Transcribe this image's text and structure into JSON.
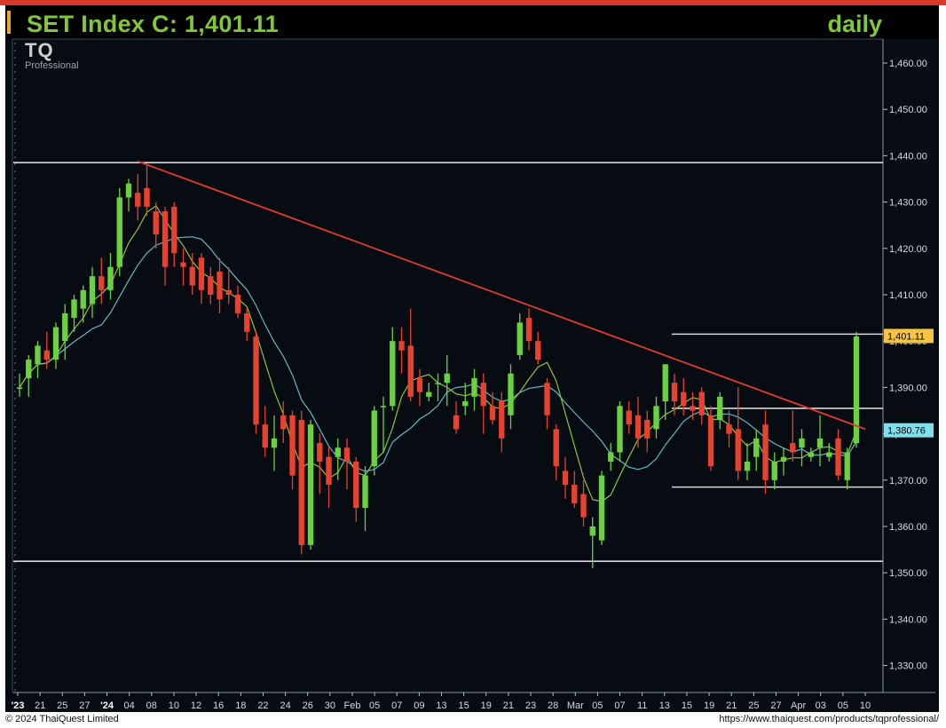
{
  "header": {
    "title": "SET Index C: 1,401.11",
    "timeframe": "daily",
    "logo_text": "TQ",
    "logo_sub": "Professional"
  },
  "footer": {
    "copyright": "© 2024 ThaiQuest Limited",
    "url": "https://www.thaiquest.com/products/tqprofessional/"
  },
  "colors": {
    "up": "#6ad23f",
    "down": "#e8412e",
    "ma_fast": "#8cc63e",
    "ma_slow": "#5fb9c9",
    "trendline": "#e23b2e",
    "hline": "#d9d9d9",
    "background": "#070b12",
    "title": "#7fc83a"
  },
  "chart_data": {
    "type": "candlestick",
    "ylim": [
      1325,
      1465
    ],
    "yticks": [
      "1,460.00",
      "1,450.00",
      "1,440.00",
      "1,430.00",
      "1,420.00",
      "1,410.00",
      "1,400.00",
      "1,390.00",
      "1,380.00",
      "1,370.00",
      "1,360.00",
      "1,350.00",
      "1,340.00",
      "1,330.00"
    ],
    "ytick_values": [
      1460,
      1450,
      1440,
      1430,
      1420,
      1410,
      1400,
      1390,
      1380,
      1370,
      1360,
      1350,
      1340,
      1330
    ],
    "xticks": [
      "'23",
      "21",
      "25",
      "27",
      "'24",
      "04",
      "08",
      "10",
      "12",
      "16",
      "18",
      "22",
      "24",
      "26",
      "30",
      "Feb",
      "05",
      "07",
      "09",
      "13",
      "15",
      "19",
      "21",
      "23",
      "28",
      "Mar",
      "05",
      "07",
      "11",
      "13",
      "15",
      "19",
      "21",
      "25",
      "27",
      "Apr",
      "03",
      "05",
      "10"
    ],
    "price_labels": [
      {
        "text": "1,401.11",
        "value": 1401.11,
        "style": "last"
      },
      {
        "text": "1,380.76",
        "value": 1380.76,
        "style": "ma"
      }
    ],
    "hlines": [
      1438.5,
      1352.5,
      1401.5,
      1385.5,
      1368.5
    ],
    "trendline": {
      "from": {
        "index": 13,
        "value": 1438.8
      },
      "to": {
        "index": 93,
        "value": 1381
      }
    },
    "ohlc": [
      [
        1390,
        1393,
        1388,
        1390
      ],
      [
        1392,
        1397,
        1388,
        1396
      ],
      [
        1395,
        1400,
        1392,
        1399
      ],
      [
        1398,
        1402,
        1394,
        1396
      ],
      [
        1396,
        1404,
        1394,
        1403
      ],
      [
        1400,
        1408,
        1396,
        1406
      ],
      [
        1405,
        1410,
        1402,
        1409
      ],
      [
        1407,
        1412,
        1404,
        1411
      ],
      [
        1408,
        1416,
        1405,
        1414
      ],
      [
        1414,
        1418,
        1408,
        1411
      ],
      [
        1411,
        1419,
        1409,
        1416
      ],
      [
        1416,
        1433,
        1414,
        1431
      ],
      [
        1431,
        1435,
        1428,
        1434
      ],
      [
        1432,
        1436,
        1426,
        1429
      ],
      [
        1433,
        1438,
        1427,
        1429
      ],
      [
        1428,
        1430,
        1420,
        1423
      ],
      [
        1428,
        1429,
        1412,
        1416
      ],
      [
        1429,
        1430,
        1416,
        1419
      ],
      [
        1417,
        1420,
        1412,
        1416
      ],
      [
        1416,
        1419,
        1410,
        1412
      ],
      [
        1418,
        1419,
        1408,
        1411
      ],
      [
        1414,
        1416,
        1408,
        1410
      ],
      [
        1415,
        1418,
        1406,
        1409
      ],
      [
        1411,
        1416,
        1408,
        1410
      ],
      [
        1410,
        1412,
        1405,
        1406
      ],
      [
        1406,
        1407,
        1400,
        1402
      ],
      [
        1401,
        1402,
        1380,
        1382
      ],
      [
        1382,
        1386,
        1375,
        1377
      ],
      [
        1377,
        1384,
        1372,
        1379
      ],
      [
        1384,
        1387,
        1378,
        1381
      ],
      [
        1384,
        1385,
        1368,
        1371
      ],
      [
        1383,
        1385,
        1354,
        1356
      ],
      [
        1356,
        1383,
        1355,
        1382
      ],
      [
        1378,
        1380,
        1367,
        1374
      ],
      [
        1375,
        1377,
        1364,
        1369
      ],
      [
        1375,
        1379,
        1370,
        1377
      ],
      [
        1377,
        1379,
        1368,
        1374
      ],
      [
        1374,
        1375,
        1361,
        1364
      ],
      [
        1364,
        1373,
        1359,
        1371
      ],
      [
        1373,
        1386,
        1371,
        1385
      ],
      [
        1386,
        1388,
        1376,
        1386
      ],
      [
        1386,
        1403,
        1385,
        1400
      ],
      [
        1400,
        1403,
        1393,
        1398
      ],
      [
        1399,
        1407,
        1387,
        1388
      ],
      [
        1392,
        1394,
        1386,
        1389
      ],
      [
        1388,
        1391,
        1387,
        1389
      ],
      [
        1391,
        1393,
        1387,
        1391
      ],
      [
        1391,
        1397,
        1386,
        1393
      ],
      [
        1384,
        1387,
        1380,
        1381
      ],
      [
        1386,
        1391,
        1384,
        1387
      ],
      [
        1388,
        1394,
        1385,
        1392
      ],
      [
        1391,
        1393,
        1380,
        1386
      ],
      [
        1386,
        1389,
        1382,
        1383
      ],
      [
        1387,
        1389,
        1376,
        1379
      ],
      [
        1384,
        1395,
        1381,
        1393
      ],
      [
        1397,
        1406,
        1396,
        1404
      ],
      [
        1405,
        1407,
        1398,
        1400
      ],
      [
        1400,
        1402,
        1395,
        1396
      ],
      [
        1391,
        1392,
        1381,
        1384
      ],
      [
        1381,
        1382,
        1370,
        1373
      ],
      [
        1372,
        1375,
        1366,
        1369
      ],
      [
        1369,
        1372,
        1364,
        1365
      ],
      [
        1367,
        1370,
        1360,
        1362
      ],
      [
        1358,
        1362,
        1351,
        1360
      ],
      [
        1357,
        1372,
        1356,
        1371
      ],
      [
        1374,
        1378,
        1372,
        1376
      ],
      [
        1376,
        1387,
        1374,
        1386
      ],
      [
        1385,
        1387,
        1380,
        1382
      ],
      [
        1384,
        1388,
        1377,
        1379
      ],
      [
        1383,
        1385,
        1376,
        1379
      ],
      [
        1381,
        1388,
        1379,
        1386
      ],
      [
        1387,
        1395,
        1383,
        1395
      ],
      [
        1391,
        1393,
        1384,
        1387
      ],
      [
        1389,
        1392,
        1384,
        1386
      ],
      [
        1386,
        1389,
        1383,
        1385
      ],
      [
        1389,
        1390,
        1382,
        1384
      ],
      [
        1384,
        1386,
        1372,
        1373
      ],
      [
        1383,
        1389,
        1381,
        1388
      ],
      [
        1382,
        1385,
        1377,
        1380
      ],
      [
        1381,
        1390,
        1370,
        1372
      ],
      [
        1372,
        1378,
        1370,
        1374
      ],
      [
        1375,
        1381,
        1372,
        1379
      ],
      [
        1382,
        1385,
        1367,
        1370
      ],
      [
        1370,
        1376,
        1368,
        1374
      ],
      [
        1374,
        1377,
        1371,
        1375
      ],
      [
        1378,
        1385,
        1374,
        1376
      ],
      [
        1377,
        1381,
        1373,
        1379
      ],
      [
        1375,
        1377,
        1374,
        1376
      ],
      [
        1377,
        1384,
        1373,
        1379
      ],
      [
        1375,
        1378,
        1374,
        1376
      ],
      [
        1379,
        1381,
        1370,
        1371
      ],
      [
        1370,
        1377,
        1368,
        1376
      ],
      [
        1378,
        1402,
        1377,
        1401
      ]
    ]
  }
}
